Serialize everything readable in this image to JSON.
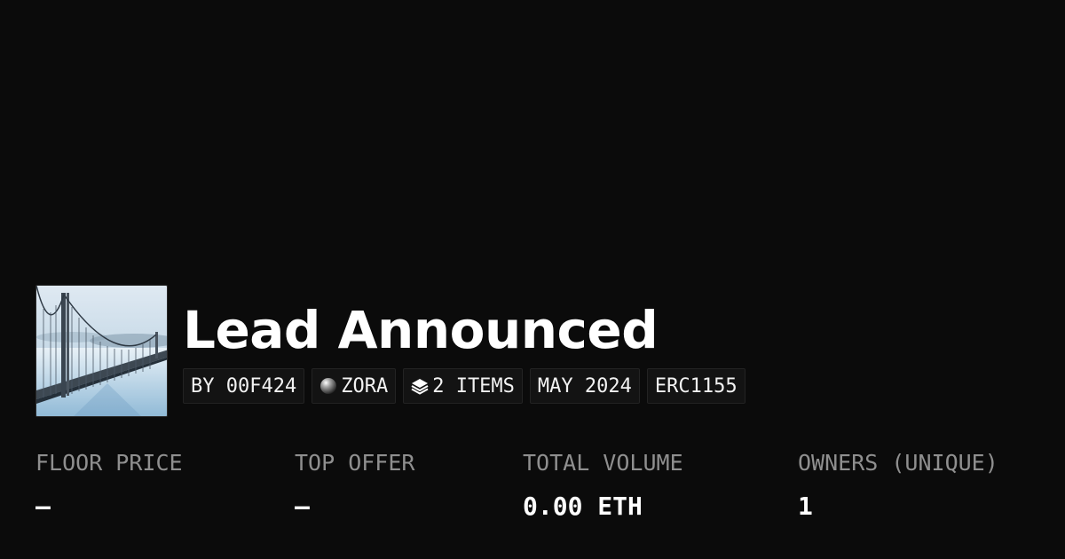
{
  "collection": {
    "title": "Lead Announced",
    "thumbnail_icon": "bridge-in-fog-image"
  },
  "badges": {
    "creator": "BY 00F424",
    "network": "ZORA",
    "network_icon": "zora-orb-icon",
    "items": "2 ITEMS",
    "items_icon": "layers-icon",
    "date": "MAY 2024",
    "standard": "ERC1155"
  },
  "stats": {
    "floor_price": {
      "label": "FLOOR PRICE",
      "value": "–"
    },
    "top_offer": {
      "label": "TOP OFFER",
      "value": "–"
    },
    "total_volume": {
      "label": "TOTAL VOLUME",
      "value": "0.00 ETH"
    },
    "owners": {
      "label": "OWNERS (UNIQUE)",
      "value": "1"
    }
  },
  "colors": {
    "background": "#0b0b0b",
    "label": "#8f8f8f",
    "text": "#ffffff",
    "badge_bg": "#131313"
  }
}
